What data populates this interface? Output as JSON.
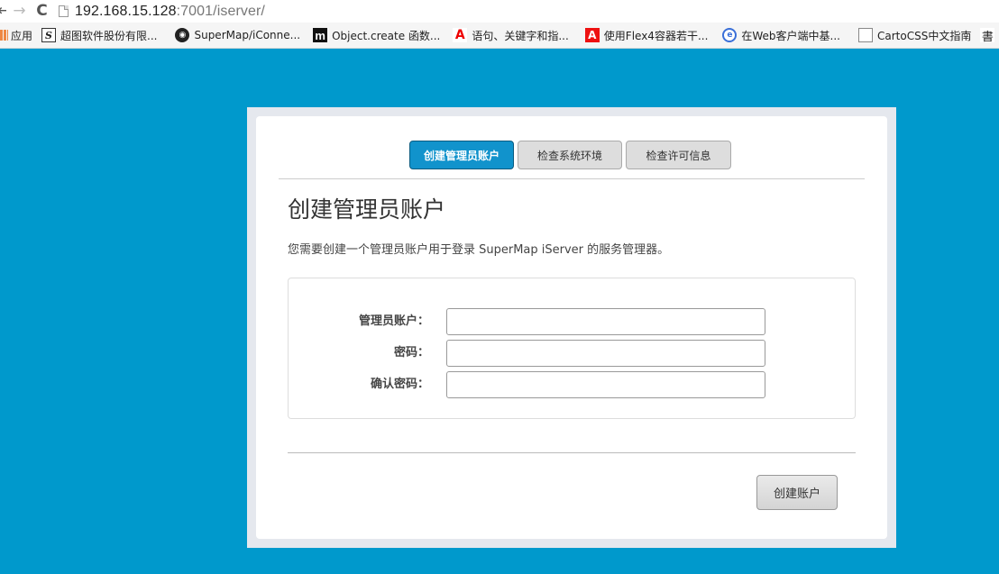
{
  "browser": {
    "url_host": "192.168.15.128",
    "url_rest": ":7001/iserver/",
    "bookmarks": [
      {
        "label": "应用",
        "icon": "apps-grid-icon"
      },
      {
        "label": "超图软件股份有限...",
        "icon": "supermap-s-icon"
      },
      {
        "label": "SuperMap/iConne...",
        "icon": "github-icon"
      },
      {
        "label": "Object.create 函数...",
        "icon": "m-logo-icon"
      },
      {
        "label": "语句、关键字和指...",
        "icon": "adobe-icon"
      },
      {
        "label": "使用Flex4容器若干...",
        "icon": "adobe-red-icon"
      },
      {
        "label": "在Web客户端中基...",
        "icon": "web-globe-icon"
      },
      {
        "label": "CartoCSS中文指南",
        "icon": "document-icon"
      }
    ]
  },
  "tabs": [
    {
      "label": "创建管理员账户",
      "active": true
    },
    {
      "label": "检查系统环境",
      "active": false
    },
    {
      "label": "检查许可信息",
      "active": false
    }
  ],
  "page": {
    "title": "创建管理员账户",
    "description": "您需要创建一个管理员账户用于登录 SuperMap iServer 的服务管理器。"
  },
  "form": {
    "username_label": "管理员账户：",
    "password_label": "密码：",
    "confirm_label": "确认密码：",
    "username_value": "",
    "password_value": "",
    "confirm_value": ""
  },
  "actions": {
    "submit_label": "创建账户"
  }
}
